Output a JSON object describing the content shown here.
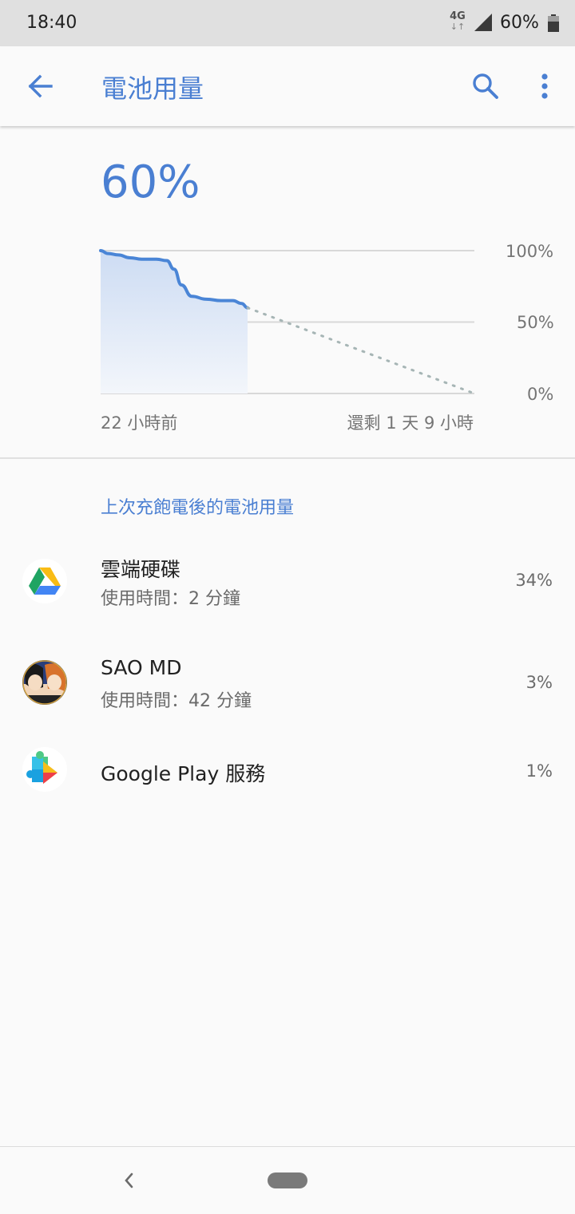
{
  "status_bar": {
    "time": "18:40",
    "network_type": "4G",
    "network_arrows": "↓↑",
    "battery_percent": "60%",
    "icons": [
      "signal-icon",
      "battery-icon"
    ]
  },
  "app_bar": {
    "title": "電池用量",
    "icons": [
      "back-arrow-icon",
      "search-icon",
      "more-vert-icon"
    ]
  },
  "battery": {
    "level": "60%"
  },
  "chart_data": {
    "type": "line",
    "ytick_labels": [
      "100%",
      "50%",
      "0%"
    ],
    "ylim": [
      0,
      100
    ],
    "x_start_label": "22 小時前",
    "x_end_label": "還剩 1 天 9 小時",
    "series": [
      {
        "values_x_fraction": [
          0.0,
          0.05,
          0.12,
          0.2,
          0.28,
          0.38,
          0.45,
          0.5,
          0.55,
          0.62,
          0.72,
          0.82,
          0.9,
          0.96,
          1.0
        ],
        "values": [
          100,
          98,
          97,
          95,
          94,
          94,
          93,
          87,
          76,
          68,
          66,
          65,
          65,
          63,
          60
        ]
      }
    ],
    "projection": {
      "from": 60,
      "to": 0
    },
    "colors": {
      "line": "#4a85d6",
      "fill": "#d6e3f6",
      "projection": "#a6b5b5",
      "grid": "#d8d8d8"
    }
  },
  "section": {
    "header": "上次充飽電後的電池用量"
  },
  "apps": [
    {
      "name": "雲端硬碟",
      "usage": "使用時間：2 分鐘",
      "percent": "34%",
      "icon": "google-drive-icon"
    },
    {
      "name": "SAO MD",
      "usage": "使用時間：42 分鐘",
      "percent": "3%",
      "icon": "sao-md-icon"
    },
    {
      "name": "Google Play 服務",
      "usage": "",
      "percent": "1%",
      "icon": "google-play-services-icon"
    }
  ],
  "nav_bar": {
    "icons": [
      "nav-back-icon",
      "nav-home-pill"
    ]
  }
}
